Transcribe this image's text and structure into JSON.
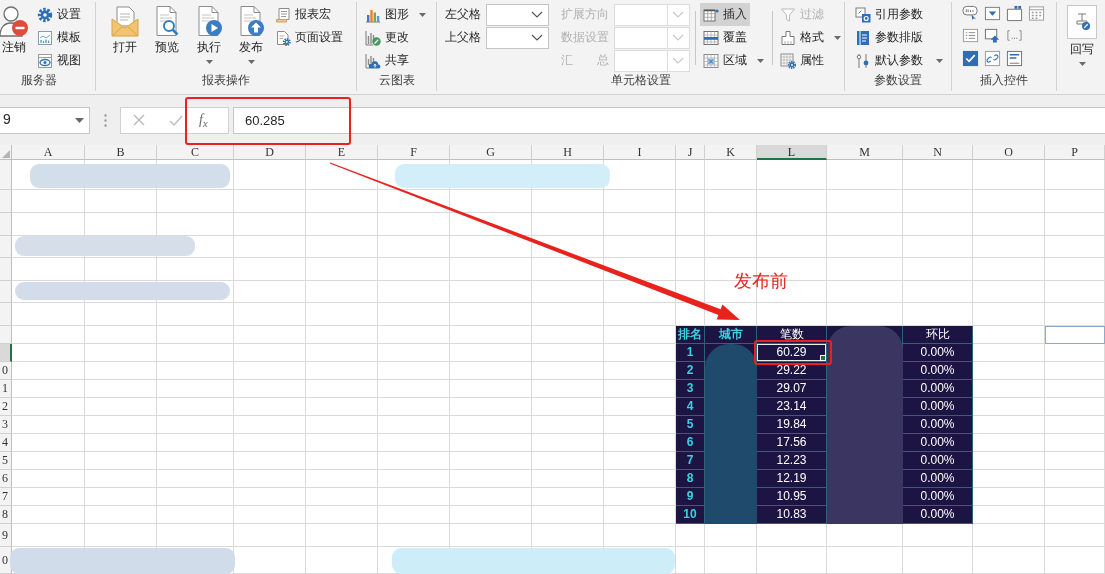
{
  "ribbon": [
    {
      "label": "服务器",
      "kind": "buttons",
      "columns": [
        [
          {
            "kind": "large",
            "label": "注销"
          }
        ],
        [
          {
            "kind": "small",
            "label": "设置"
          },
          {
            "kind": "small",
            "label": "模板"
          },
          {
            "kind": "small",
            "label": "视图"
          }
        ]
      ]
    },
    {
      "label": "报表操作",
      "kind": "buttons",
      "columns": [
        [
          {
            "kind": "large",
            "label": "打开"
          }
        ],
        [
          {
            "kind": "large",
            "label": "预览"
          }
        ],
        [
          {
            "kind": "large",
            "label": "执行",
            "dropdown": true
          }
        ],
        [
          {
            "kind": "large",
            "label": "发布",
            "dropdown": true
          }
        ],
        [
          {
            "kind": "small",
            "label": "报表宏"
          },
          {
            "kind": "small",
            "label": "页面设置"
          }
        ]
      ]
    },
    {
      "label": "云图表",
      "kind": "buttons",
      "columns": [
        [
          {
            "kind": "small",
            "label": "图形",
            "dropdown": true
          },
          {
            "kind": "small",
            "label": "更改"
          },
          {
            "kind": "small",
            "label": "共享"
          }
        ]
      ]
    },
    {
      "label": "单元格设置",
      "kind": "buttons",
      "columns": [
        [
          {
            "kind": "combo",
            "label": "左父格",
            "disabled": false
          },
          {
            "kind": "combo",
            "label": "上父格",
            "disabled": false
          }
        ],
        [
          {
            "kind": "combo",
            "label": "扩展方向",
            "disabled": true
          },
          {
            "kind": "combo",
            "label": "数据设置",
            "disabled": true
          },
          {
            "kind": "combo",
            "label": "汇 总",
            "disabled": true
          }
        ],
        [
          {
            "kind": "small",
            "label": "插入",
            "selected": true
          },
          {
            "kind": "small",
            "label": "覆盖",
            "selected": false
          },
          {
            "kind": "small",
            "label": "区域",
            "selected": false,
            "dropdown": true
          }
        ],
        [
          {
            "kind": "small",
            "label": "过滤",
            "disabled": true
          },
          {
            "kind": "small",
            "label": "格式",
            "disabled": false,
            "dropdown": true
          },
          {
            "kind": "small",
            "label": "属性",
            "disabled": false
          }
        ]
      ]
    },
    {
      "label": "参数设置",
      "kind": "buttons",
      "columns": [
        [
          {
            "kind": "small",
            "label": "引用参数"
          },
          {
            "kind": "small",
            "label": "参数排版"
          },
          {
            "kind": "small",
            "label": "默认参数",
            "dropdown": true
          }
        ]
      ]
    },
    {
      "label": "插入控件",
      "kind": "palette"
    },
    {
      "kind": "buttons",
      "columns": [
        [
          {
            "kind": "large",
            "label": "回写",
            "dropdown": true
          }
        ]
      ]
    }
  ],
  "formula_bar": {
    "name_box": "9",
    "function_button": "f$_{x}$",
    "formula": "60.285"
  },
  "sheet": {
    "columns": [
      {
        "label": "A",
        "selected": false
      },
      {
        "label": "B",
        "selected": false
      },
      {
        "label": "C",
        "selected": false
      },
      {
        "label": "D",
        "selected": false
      },
      {
        "label": "E",
        "selected": false
      },
      {
        "label": "F",
        "selected": false
      },
      {
        "label": "G",
        "selected": false
      },
      {
        "label": "H",
        "selected": false
      },
      {
        "label": "I",
        "selected": false
      },
      {
        "label": "J",
        "selected": false
      },
      {
        "label": "K",
        "selected": false
      },
      {
        "label": "L",
        "selected": true
      },
      {
        "label": "M",
        "selected": false
      },
      {
        "label": "N",
        "selected": false
      },
      {
        "label": "O",
        "selected": false
      },
      {
        "label": "P",
        "selected": false
      }
    ],
    "rows": [
      {
        "selected": false
      },
      {
        "selected": false
      },
      {
        "selected": false
      },
      {
        "selected": false
      },
      {
        "selected": false
      },
      {
        "selected": false
      },
      {
        "selected": false
      },
      {
        "selected": false
      },
      {
        "selected": true
      },
      {
        "label": "0",
        "selected": false
      },
      {
        "label": "1",
        "selected": false
      },
      {
        "label": "2",
        "selected": false
      },
      {
        "label": "3",
        "selected": false
      },
      {
        "label": "4",
        "selected": false
      },
      {
        "label": "5",
        "selected": false
      },
      {
        "label": "6",
        "selected": false
      },
      {
        "label": "7",
        "selected": false
      },
      {
        "label": "8",
        "selected": false
      },
      {
        "label": "9",
        "selected": false
      },
      {
        "label": "0",
        "selected": false
      }
    ],
    "table": {
      "columns": [
        {
          "heading": "排名",
          "kind": "key"
        },
        {
          "heading": "城市",
          "kind": "key"
        },
        {
          "heading": "笔数",
          "kind": "metric"
        },
        {
          "kind": "metric"
        },
        {
          "heading": "环比",
          "kind": "metric"
        }
      ],
      "rows": [
        {
          "cells": [
            "1",
            "",
            "60.29",
            "",
            "0.00%"
          ]
        },
        {
          "cells": [
            "2",
            "",
            "29.22",
            "",
            "0.00%"
          ]
        },
        {
          "cells": [
            "3",
            "",
            "29.07",
            "",
            "0.00%"
          ]
        },
        {
          "cells": [
            "4",
            "",
            "23.14",
            "",
            "0.00%"
          ]
        },
        {
          "cells": [
            "5",
            "",
            "19.84",
            "",
            "0.00%"
          ]
        },
        {
          "cells": [
            "6",
            "",
            "17.56",
            "",
            "0.00%"
          ]
        },
        {
          "cells": [
            "7",
            "",
            "12.23",
            "",
            "0.00%"
          ]
        },
        {
          "cells": [
            "8",
            "",
            "12.19",
            "",
            "0.00%"
          ]
        },
        {
          "cells": [
            "9",
            "",
            "10.95",
            "",
            "0.00%"
          ]
        },
        {
          "cells": [
            "10",
            "",
            "10.83",
            "",
            "0.00%"
          ]
        }
      ],
      "pixelated_areas": [
        {
          "color": "#1f4a6b"
        },
        {
          "color": "#3b3561"
        }
      ]
    }
  },
  "blurred_areas": [
    {
      "color": "#d3deeb"
    },
    {
      "color": "#d2eef8"
    },
    {
      "color": "#d6deea"
    },
    {
      "color": "#d3dcea"
    },
    {
      "color": "#d0dcea"
    },
    {
      "color": "#cdeef9"
    }
  ],
  "annotations": [
    {
      "kind": "highlight"
    },
    {
      "kind": "arrow"
    },
    {
      "kind": "label",
      "text": "发布前"
    },
    {
      "kind": "highlight"
    }
  ]
}
